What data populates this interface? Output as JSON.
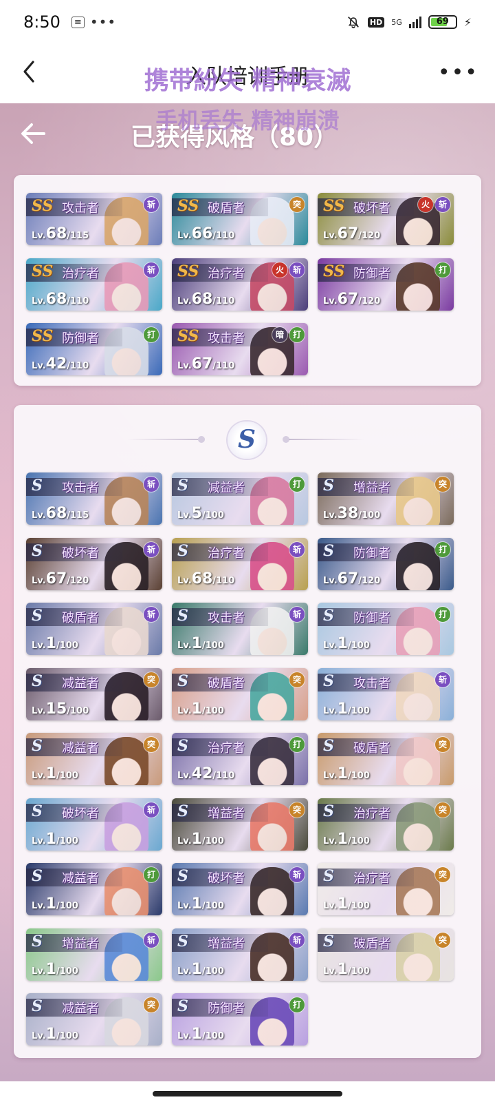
{
  "status": {
    "time": "8:50",
    "notif": "≡",
    "dots": "•••",
    "hd": "HD",
    "network": "5G",
    "battery": "69",
    "bolt": "⚡"
  },
  "header": {
    "title": "入队培训手册",
    "overlay1": "携带紛失 精神衰滅",
    "overlay2": "手机丢失 精神崩溃",
    "more": "•••"
  },
  "game": {
    "title": "已获得风格（80）"
  },
  "ss_section": {
    "rank_label": "SS",
    "cards": [
      {
        "role": "攻击者",
        "lv_prefix": "Lv.",
        "level": "68",
        "max": "/115",
        "badges": [
          {
            "t": "斩",
            "c": "slash"
          }
        ],
        "bg": "#6b7db8",
        "hair": "#d9a66b"
      },
      {
        "role": "破盾者",
        "lv_prefix": "Lv.",
        "level": "66",
        "max": "/110",
        "badges": [
          {
            "t": "突",
            "c": "pierce"
          }
        ],
        "bg": "#2c8a9a",
        "hair": "#e8ecf6"
      },
      {
        "role": "破坏者",
        "lv_prefix": "Lv.",
        "level": "67",
        "max": "/120",
        "badges": [
          {
            "t": "火",
            "c": "fire"
          },
          {
            "t": "斩",
            "c": "slash"
          }
        ],
        "bg": "#8a8c3a",
        "hair": "#3a2a34"
      },
      {
        "role": "治疗者",
        "lv_prefix": "Lv.",
        "level": "68",
        "max": "/110",
        "badges": [
          {
            "t": "斩",
            "c": "slash"
          }
        ],
        "bg": "#4aa8c8",
        "hair": "#e89ab8"
      },
      {
        "role": "治疗者",
        "lv_prefix": "Lv.",
        "level": "68",
        "max": "/110",
        "badges": [
          {
            "t": "火",
            "c": "fire"
          },
          {
            "t": "斩",
            "c": "slash"
          }
        ],
        "bg": "#4b3e7a",
        "hair": "#c44a66"
      },
      {
        "role": "防御者",
        "lv_prefix": "Lv.",
        "level": "67",
        "max": "/120",
        "badges": [
          {
            "t": "打",
            "c": "strike"
          }
        ],
        "bg": "#7a3aa0",
        "hair": "#5a3a2a"
      },
      {
        "role": "防御者",
        "lv_prefix": "Lv.",
        "level": "42",
        "max": "/110",
        "badges": [
          {
            "t": "打",
            "c": "strike"
          }
        ],
        "bg": "#3a6ab8",
        "hair": "#d8dde8"
      },
      {
        "role": "攻击者",
        "lv_prefix": "Lv.",
        "level": "67",
        "max": "/110",
        "badges": [
          {
            "t": "暗",
            "c": "dark"
          },
          {
            "t": "打",
            "c": "strike"
          }
        ],
        "bg": "#9a5ab0",
        "hair": "#3a2a30"
      }
    ]
  },
  "s_section": {
    "emblem": "S",
    "rank_label": "S",
    "cards": [
      {
        "role": "攻击者",
        "lv_prefix": "Lv.",
        "level": "68",
        "max": "/115",
        "badges": [
          {
            "t": "斩",
            "c": "slash"
          }
        ],
        "bg": "#4a74b0",
        "hair": "#b8855a"
      },
      {
        "role": "减益者",
        "lv_prefix": "Lv.",
        "level": "5",
        "max": "/100",
        "badges": [
          {
            "t": "打",
            "c": "strike"
          }
        ],
        "bg": "#b8c8e0",
        "hair": "#d87aa0"
      },
      {
        "role": "增益者",
        "lv_prefix": "Lv.",
        "level": "38",
        "max": "/100",
        "badges": [
          {
            "t": "突",
            "c": "pierce"
          }
        ],
        "bg": "#7a6a5a",
        "hair": "#e8c88a"
      },
      {
        "role": "破坏者",
        "lv_prefix": "Lv.",
        "level": "67",
        "max": "/120",
        "badges": [
          {
            "t": "斩",
            "c": "slash"
          }
        ],
        "bg": "#5a4032",
        "hair": "#2a2026"
      },
      {
        "role": "治疗者",
        "lv_prefix": "Lv.",
        "level": "68",
        "max": "/110",
        "badges": [
          {
            "t": "斩",
            "c": "slash"
          }
        ],
        "bg": "#b8a050",
        "hair": "#d8508a"
      },
      {
        "role": "防御者",
        "lv_prefix": "Lv.",
        "level": "67",
        "max": "/120",
        "badges": [
          {
            "t": "打",
            "c": "strike"
          }
        ],
        "bg": "#3a5a8a",
        "hair": "#2a2228"
      },
      {
        "role": "破盾者",
        "lv_prefix": "Lv.",
        "level": "1",
        "max": "/100",
        "badges": [
          {
            "t": "斩",
            "c": "slash"
          }
        ],
        "bg": "#6a7aa8",
        "hair": "#e8d8d0"
      },
      {
        "role": "攻击者",
        "lv_prefix": "Lv.",
        "level": "1",
        "max": "/100",
        "badges": [
          {
            "t": "斩",
            "c": "slash"
          }
        ],
        "bg": "#3a7a6a",
        "hair": "#f0f0f0"
      },
      {
        "role": "防御者",
        "lv_prefix": "Lv.",
        "level": "1",
        "max": "/100",
        "badges": [
          {
            "t": "打",
            "c": "strike"
          }
        ],
        "bg": "#a8c8e0",
        "hair": "#e8a0b8"
      },
      {
        "role": "减益者",
        "lv_prefix": "Lv.",
        "level": "15",
        "max": "/100",
        "badges": [
          {
            "t": "突",
            "c": "pierce"
          }
        ],
        "bg": "#6a5a6a",
        "hair": "#2a1e28"
      },
      {
        "role": "破盾者",
        "lv_prefix": "Lv.",
        "level": "1",
        "max": "/100",
        "badges": [
          {
            "t": "突",
            "c": "pierce"
          }
        ],
        "bg": "#d8a08a",
        "hair": "#4aa8a0"
      },
      {
        "role": "攻击者",
        "lv_prefix": "Lv.",
        "level": "1",
        "max": "/100",
        "badges": [
          {
            "t": "斩",
            "c": "slash"
          }
        ],
        "bg": "#8ab0d8",
        "hair": "#f0d8c0"
      },
      {
        "role": "减益者",
        "lv_prefix": "Lv.",
        "level": "1",
        "max": "/100",
        "badges": [
          {
            "t": "突",
            "c": "pierce"
          }
        ],
        "bg": "#c89a7a",
        "hair": "#7a4a2a"
      },
      {
        "role": "治疗者",
        "lv_prefix": "Lv.",
        "level": "42",
        "max": "/110",
        "badges": [
          {
            "t": "打",
            "c": "strike"
          }
        ],
        "bg": "#7a70a8",
        "hair": "#3a3040"
      },
      {
        "role": "破盾者",
        "lv_prefix": "Lv.",
        "level": "1",
        "max": "/100",
        "badges": [
          {
            "t": "突",
            "c": "pierce"
          }
        ],
        "bg": "#c89a6a",
        "hair": "#f0c8c8"
      },
      {
        "role": "破坏者",
        "lv_prefix": "Lv.",
        "level": "1",
        "max": "/100",
        "badges": [
          {
            "t": "斩",
            "c": "slash"
          }
        ],
        "bg": "#6aa8d0",
        "hair": "#c8a0e0"
      },
      {
        "role": "增益者",
        "lv_prefix": "Lv.",
        "level": "1",
        "max": "/100",
        "badges": [
          {
            "t": "突",
            "c": "pierce"
          }
        ],
        "bg": "#4a4a3a",
        "hair": "#e87a6a"
      },
      {
        "role": "治疗者",
        "lv_prefix": "Lv.",
        "level": "1",
        "max": "/100",
        "badges": [
          {
            "t": "突",
            "c": "pierce"
          }
        ],
        "bg": "#6a7a4a",
        "hair": "#8a9a7a"
      },
      {
        "role": "减益者",
        "lv_prefix": "Lv.",
        "level": "1",
        "max": "/100",
        "badges": [
          {
            "t": "打",
            "c": "strike"
          }
        ],
        "bg": "#2a3a6a",
        "hair": "#e89070"
      },
      {
        "role": "破坏者",
        "lv_prefix": "Lv.",
        "level": "1",
        "max": "/100",
        "badges": [
          {
            "t": "斩",
            "c": "slash"
          }
        ],
        "bg": "#5a7ab0",
        "hair": "#3a2a2a"
      },
      {
        "role": "治疗者",
        "lv_prefix": "Lv.",
        "level": "1",
        "max": "/100",
        "badges": [
          {
            "t": "突",
            "c": "pierce"
          }
        ],
        "bg": "#f0ece8",
        "hair": "#a87a5a"
      },
      {
        "role": "增益者",
        "lv_prefix": "Lv.",
        "level": "1",
        "max": "/100",
        "badges": [
          {
            "t": "斩",
            "c": "slash"
          }
        ],
        "bg": "#8ac88a",
        "hair": "#5a8ad8"
      },
      {
        "role": "增益者",
        "lv_prefix": "Lv.",
        "level": "1",
        "max": "/100",
        "badges": [
          {
            "t": "斩",
            "c": "slash"
          }
        ],
        "bg": "#8aa0c8",
        "hair": "#4a3028"
      },
      {
        "role": "破盾者",
        "lv_prefix": "Lv.",
        "level": "1",
        "max": "/100",
        "badges": [
          {
            "t": "突",
            "c": "pierce"
          }
        ],
        "bg": "#e8e4e0",
        "hair": "#d8d0a8"
      },
      {
        "role": "减益者",
        "lv_prefix": "Lv.",
        "level": "1",
        "max": "/100",
        "badges": [
          {
            "t": "突",
            "c": "pierce"
          }
        ],
        "bg": "#a8b0c8",
        "hair": "#d8d8e0"
      },
      {
        "role": "防御者",
        "lv_prefix": "Lv.",
        "level": "1",
        "max": "/100",
        "badges": [
          {
            "t": "打",
            "c": "strike"
          }
        ],
        "bg": "#b8a0e0",
        "hair": "#6a4ab8"
      }
    ]
  }
}
